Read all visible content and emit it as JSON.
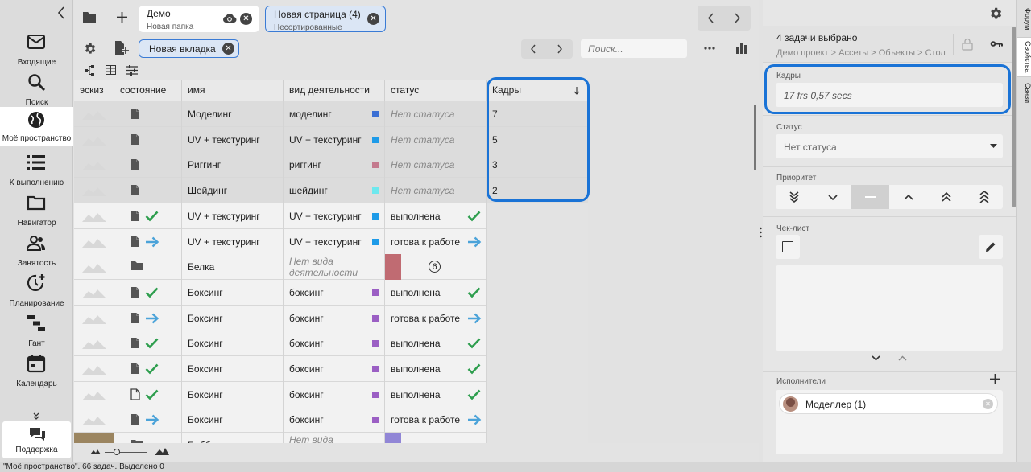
{
  "nav": {
    "items": [
      {
        "label": "Входящие",
        "icon": "mail-icon"
      },
      {
        "label": "Поиск",
        "icon": "search-icon"
      },
      {
        "label": "Моё пространство",
        "icon": "globe-icon"
      },
      {
        "label": "К выполнению",
        "icon": "list-icon"
      },
      {
        "label": "Навигатор",
        "icon": "folder-icon"
      },
      {
        "label": "Занятость",
        "icon": "people-icon"
      },
      {
        "label": "Планирование",
        "icon": "schedule-icon"
      },
      {
        "label": "Гант",
        "icon": "gantt-icon"
      },
      {
        "label": "Календарь",
        "icon": "calendar-icon"
      }
    ],
    "support": "Поддержка"
  },
  "tabs": [
    {
      "title": "Демо",
      "subtitle": "Новая папка"
    },
    {
      "title": "Новая страница (4)",
      "subtitle": "Несортированные"
    }
  ],
  "toolbar": {
    "new_tab": "Новая вкладка",
    "search_placeholder": "Поиск..."
  },
  "table": {
    "headers": [
      "эскиз",
      "состояние",
      "имя",
      "вид деятельности",
      "статус",
      "Кадры"
    ],
    "rows": [
      {
        "name": "Моделинг",
        "activity": "моделинг",
        "status": "Нет статуса",
        "frames": "7",
        "act_color": "#3b6fd4"
      },
      {
        "name": "UV + текстуринг",
        "activity": "UV + текстуринг",
        "status": "Нет статуса",
        "frames": "5",
        "act_color": "#1e9be8"
      },
      {
        "name": "Риггинг",
        "activity": "риггинг",
        "status": "Нет статуса",
        "frames": "3",
        "act_color": "#c47a8e"
      },
      {
        "name": "Шейдинг",
        "activity": "шейдинг",
        "status": "Нет статуса",
        "frames": "2",
        "act_color": "#6ee8ee"
      },
      {
        "name": "UV + текстуринг",
        "activity": "UV + текстуринг",
        "status": "выполнена",
        "frames": "",
        "act_color": "#1e9be8"
      },
      {
        "name": "UV + текстуринг",
        "activity": "UV + текстуринг",
        "status": "готова к работе",
        "frames": "",
        "act_color": "#1e9be8"
      },
      {
        "name": "Белка",
        "activity": "Нет вида деятельности",
        "status": "6",
        "frames": "",
        "act_color": ""
      },
      {
        "name": "Боксинг",
        "activity": "боксинг",
        "status": "выполнена",
        "frames": "",
        "act_color": "#9b5fc4"
      },
      {
        "name": "Боксинг",
        "activity": "боксинг",
        "status": "готова к работе",
        "frames": "",
        "act_color": "#9b5fc4"
      },
      {
        "name": "Боксинг",
        "activity": "боксинг",
        "status": "выполнена",
        "frames": "",
        "act_color": "#9b5fc4"
      },
      {
        "name": "Боксинг",
        "activity": "боксинг",
        "status": "выполнена",
        "frames": "",
        "act_color": "#9b5fc4"
      },
      {
        "name": "Боксинг",
        "activity": "боксинг",
        "status": "выполнена",
        "frames": "",
        "act_color": "#9b5fc4"
      },
      {
        "name": "Боксинг",
        "activity": "боксинг",
        "status": "готова к работе",
        "frames": "",
        "act_color": "#9b5fc4"
      },
      {
        "name": "Бибби",
        "activity": "Нет вида",
        "status": "",
        "frames": "",
        "act_color": ""
      }
    ]
  },
  "panel": {
    "title": "4 задачи выбрано",
    "breadcrumb": "Демо проект > Ассеты > Объекты > Стол",
    "frames_label": "Кадры",
    "frames_value": "17 frs 0,57 secs",
    "status_label": "Статус",
    "status_value": "Нет статуса",
    "priority_label": "Приоритет",
    "checklist_label": "Чек-лист",
    "assignees_label": "Исполнители",
    "assignee": "Моделлер (1)"
  },
  "sidetabs": [
    "Форум",
    "Свойства",
    "Связи"
  ],
  "statusbar": "\"Моё пространство\". 66 задач. Выделено 0",
  "colors": {
    "accent": "#1a73d6",
    "done": "#2e9e4e",
    "ready": "#4ba3d9",
    "belka": "#c06b72",
    "bibbi": "#9186d6"
  }
}
